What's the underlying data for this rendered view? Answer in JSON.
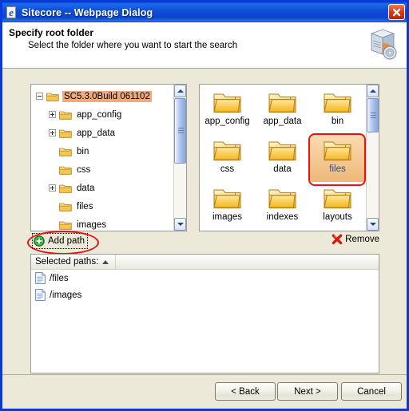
{
  "window": {
    "title": "Sitecore -- Webpage Dialog",
    "title_icon": "ie-page-icon",
    "close_label": "close-icon",
    "border_color": "#0a3ad6",
    "titlebar_color": "#0f4fd8"
  },
  "header": {
    "title": "Specify root folder",
    "subtitle": "Select the folder where you want to start the search",
    "icon": "software-package-cd-icon"
  },
  "tree": {
    "items": [
      {
        "label": "SC5.3.0Build 061102",
        "depth": 0,
        "expander": "minus",
        "selected": true
      },
      {
        "label": "app_config",
        "depth": 1,
        "expander": "plus",
        "selected": false
      },
      {
        "label": "app_data",
        "depth": 1,
        "expander": "plus",
        "selected": false
      },
      {
        "label": "bin",
        "depth": 1,
        "expander": "none",
        "selected": false
      },
      {
        "label": "css",
        "depth": 1,
        "expander": "none",
        "selected": false
      },
      {
        "label": "data",
        "depth": 1,
        "expander": "plus",
        "selected": false
      },
      {
        "label": "files",
        "depth": 1,
        "expander": "none",
        "selected": false
      },
      {
        "label": "images",
        "depth": 1,
        "expander": "none",
        "selected": false
      }
    ],
    "selection_color": "#f0ab7c"
  },
  "folder_grid": {
    "items": [
      {
        "label": "app_config",
        "selected": false
      },
      {
        "label": "app_data",
        "selected": false
      },
      {
        "label": "bin",
        "selected": false
      },
      {
        "label": "css",
        "selected": false
      },
      {
        "label": "data",
        "selected": false
      },
      {
        "label": "files",
        "selected": true
      },
      {
        "label": "images",
        "selected": false
      },
      {
        "label": "indexes",
        "selected": false
      },
      {
        "label": "layouts",
        "selected": false
      }
    ],
    "selected_label_color": "#31489c",
    "selection_color": "#f5c893"
  },
  "toolbar": {
    "add_path_label": "Add path",
    "add_path_icon": "green-plus-circle-icon",
    "remove_label": "Remove",
    "remove_icon": "red-x-icon"
  },
  "selected_paths_list": {
    "column_header": "Selected paths:",
    "sort_direction": "ascending",
    "rows": [
      {
        "path": "/files",
        "icon": "document-icon"
      },
      {
        "path": "/images",
        "icon": "document-icon"
      }
    ]
  },
  "footer": {
    "back_label": "< Back",
    "next_label": "Next >",
    "cancel_label": "Cancel"
  },
  "annotations": {
    "color": "#e81010",
    "shapes": [
      "ellipse-around-add-path",
      "rect-around-files-folder"
    ]
  }
}
